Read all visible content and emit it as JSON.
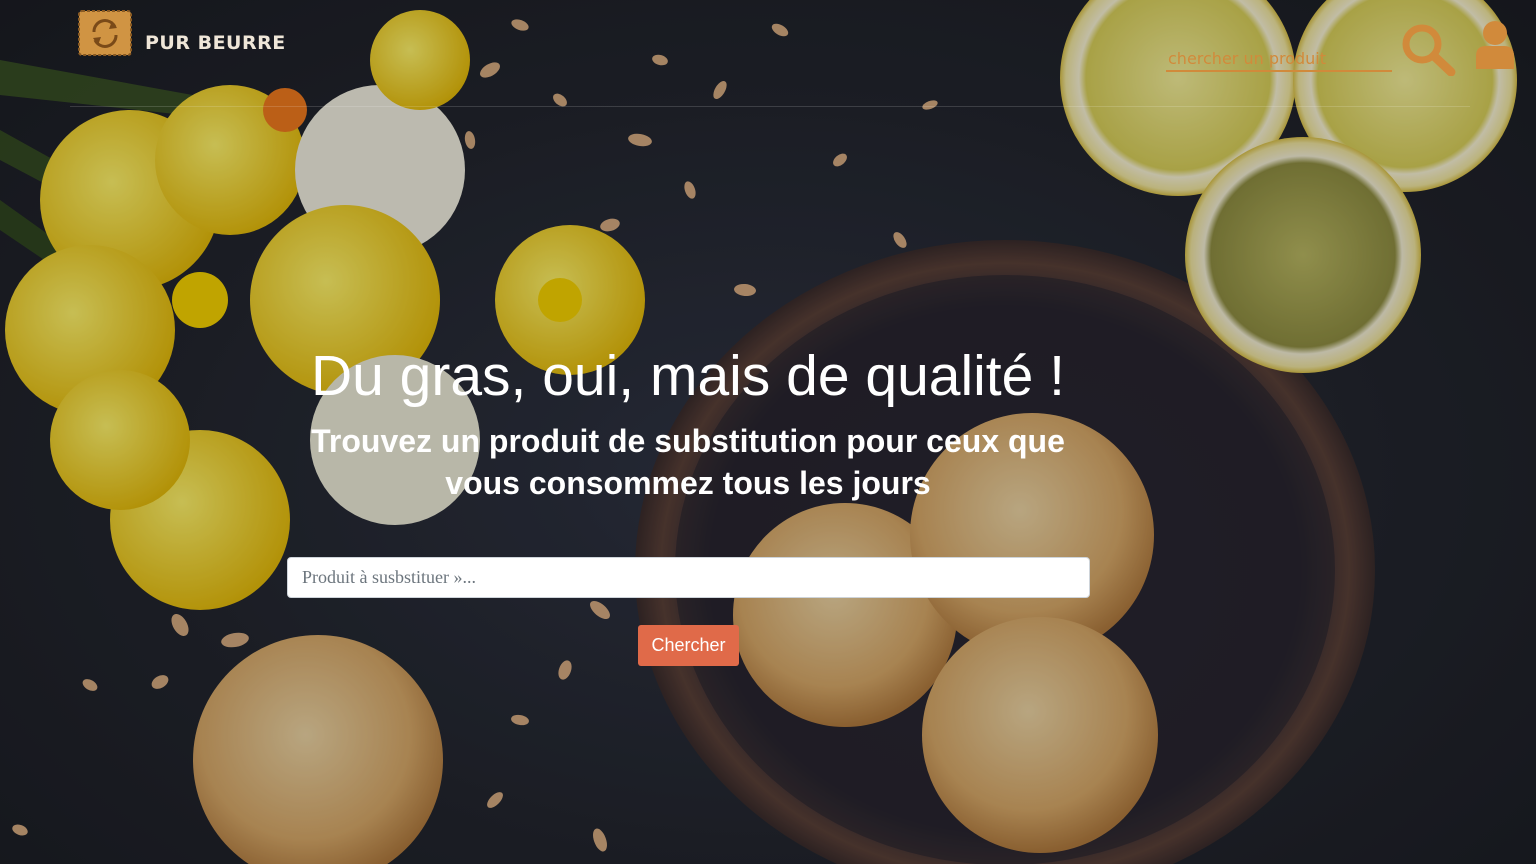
{
  "navbar": {
    "brand_name": "PUR BEURRE",
    "search_placeholder": "chercher un produit"
  },
  "hero": {
    "title": "Du gras, oui, mais de qualité !",
    "subtitle": "Trouvez un produit de substitution pour ceux que vous consommez tous les jours",
    "search_placeholder": "Produit à susbstituer »...",
    "button_label": "Chercher"
  },
  "icons": {
    "logo": "cookie-refresh-logo",
    "search": "search-icon",
    "user": "user-icon"
  },
  "colors": {
    "accent": "#d18a3b",
    "button": "#e06a49",
    "background": "#23262f",
    "text": "#ffffff"
  }
}
